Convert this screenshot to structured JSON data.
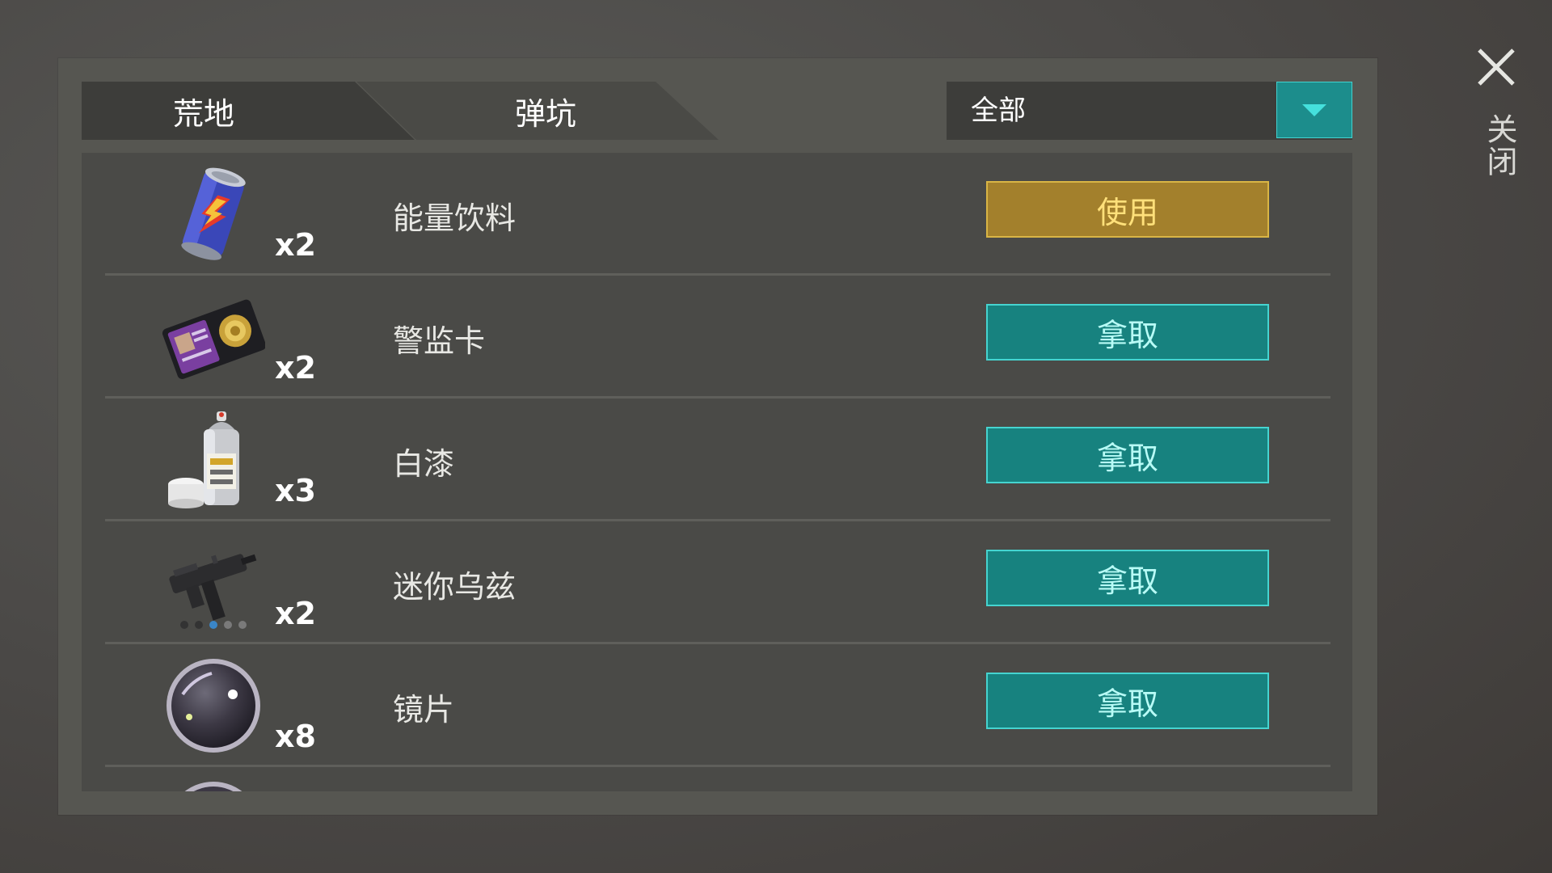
{
  "tabs": [
    {
      "label": "荒地"
    },
    {
      "label": "弹坑"
    }
  ],
  "filter": {
    "selected": "全部"
  },
  "items": [
    {
      "icon": "energy-drink-icon",
      "count": "x2",
      "name": "能量饮料",
      "action": "使用"
    },
    {
      "icon": "police-badge-icon",
      "count": "x2",
      "name": "警监卡",
      "action": "拿取"
    },
    {
      "icon": "spray-paint-icon",
      "count": "x3",
      "name": "白漆",
      "action": "拿取"
    },
    {
      "icon": "mini-uzi-icon",
      "count": "x2",
      "name": "迷你乌兹",
      "action": "拿取"
    },
    {
      "icon": "lens-icon",
      "count": "x8",
      "name": "镜片",
      "action": "拿取"
    }
  ],
  "close": {
    "label": "关闭"
  },
  "colors": {
    "use_button": "#a3802c",
    "take_button": "#17827f",
    "accent": "#45d4d0"
  }
}
